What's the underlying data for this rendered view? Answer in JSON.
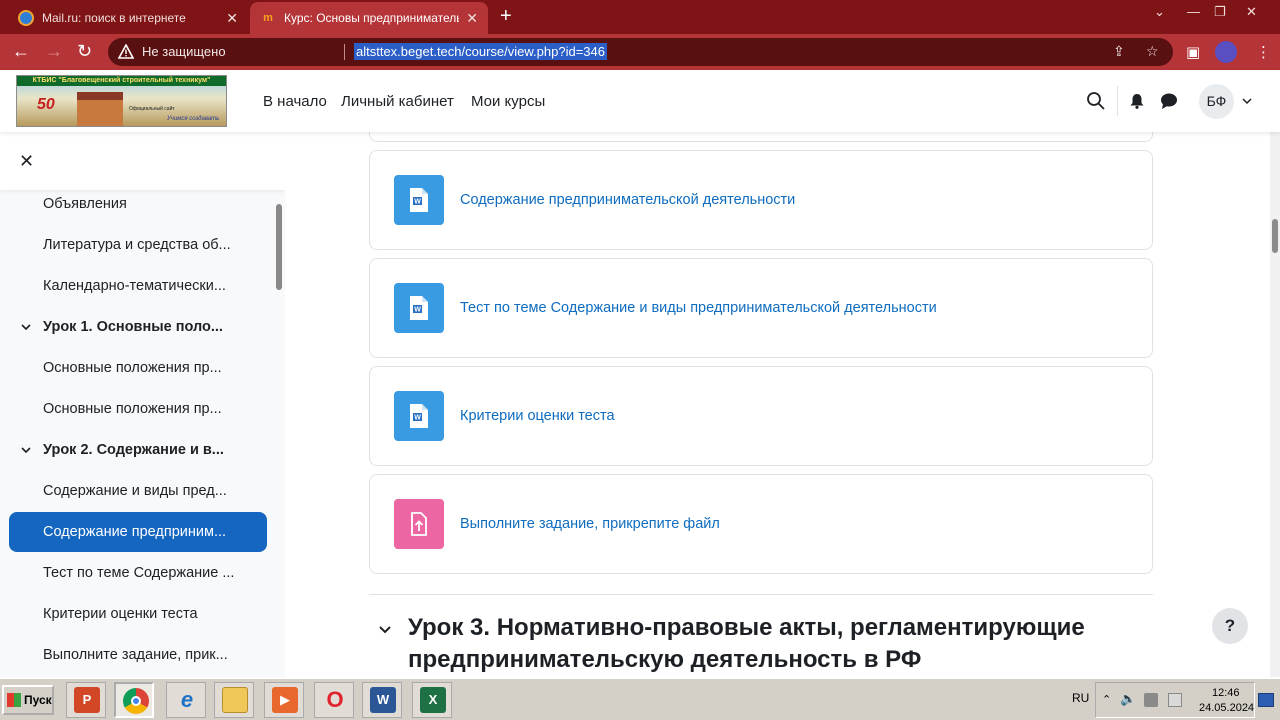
{
  "browser": {
    "tabs": [
      {
        "title": "Mail.ru: поиск в интернете",
        "active": false
      },
      {
        "title": "Курс: Основы предпринимательс",
        "active": true
      }
    ],
    "favicon_text": "m",
    "address": {
      "security_label": "Не защищено",
      "url": "altsttex.beget.tech/course/view.php?id=346"
    }
  },
  "site": {
    "logo": {
      "strip_text": "КТБИС \"Благовещенский строительный техникум\"",
      "anniversary": "50",
      "tagline": "Официальный сайт",
      "motto": "Учимся создавать"
    },
    "nav": [
      {
        "label": "В начало"
      },
      {
        "label": "Личный кабинет"
      },
      {
        "label": "Мои курсы"
      }
    ],
    "user_initials": "БФ"
  },
  "course_index": {
    "items": [
      {
        "label": "Объявления",
        "type": "activity"
      },
      {
        "label": "Литература и средства об...",
        "type": "activity"
      },
      {
        "label": "Календарно-тематически...",
        "type": "activity"
      },
      {
        "label": "Урок 1. Основные поло...",
        "type": "section"
      },
      {
        "label": "Основные положения пр...",
        "type": "activity"
      },
      {
        "label": "Основные положения пр...",
        "type": "activity"
      },
      {
        "label": "Урок 2. Содержание и в...",
        "type": "section"
      },
      {
        "label": "Содержание и виды пред...",
        "type": "activity"
      },
      {
        "label": "Содержание предприним...",
        "type": "activity",
        "active": true
      },
      {
        "label": "Тест по теме Содержание ...",
        "type": "activity"
      },
      {
        "label": "Критерии оценки теста",
        "type": "activity"
      },
      {
        "label": "Выполните задание, прик...",
        "type": "activity"
      }
    ]
  },
  "main": {
    "activities": [
      {
        "title": "Содержание предпринимательской деятельности",
        "icon": "word-file-icon",
        "icon_color": "#399be2"
      },
      {
        "title": "Тест по теме Содержание и виды предпринимательской деятельности",
        "icon": "word-file-icon",
        "icon_color": "#399be2"
      },
      {
        "title": "Критерии оценки теста",
        "icon": "word-file-icon",
        "icon_color": "#399be2"
      },
      {
        "title": "Выполните задание, прикрепите файл",
        "icon": "assignment-icon",
        "icon_color": "#eb66a2"
      }
    ],
    "next_section_title": "Урок 3. Нормативно-правовые акты, регламентирующие предпринимательскую деятельность в РФ",
    "help_label": "?"
  },
  "taskbar": {
    "start_label": "Пуск",
    "apps": [
      {
        "name": "powerpoint",
        "glyph": "P"
      },
      {
        "name": "chrome",
        "glyph": ""
      },
      {
        "name": "internet-explorer",
        "glyph": "e"
      },
      {
        "name": "file-explorer",
        "glyph": ""
      },
      {
        "name": "media-player",
        "glyph": "▶"
      },
      {
        "name": "opera",
        "glyph": "O"
      },
      {
        "name": "word",
        "glyph": "W"
      },
      {
        "name": "excel",
        "glyph": "X"
      }
    ],
    "language": "RU",
    "time": "12:46",
    "date": "24.05.2024"
  },
  "colors": {
    "browser_tabbar": "#7f1416",
    "browser_toolbar": "#b53437",
    "link": "#0f6cbf",
    "active_item": "#1566c0"
  }
}
